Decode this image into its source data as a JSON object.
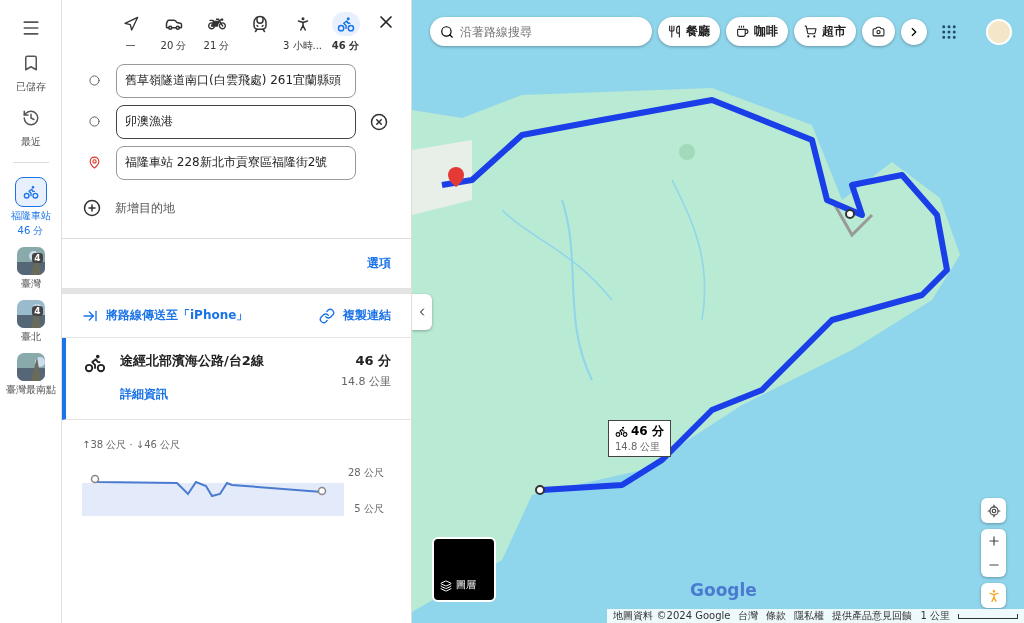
{
  "rail": {
    "items": [
      {
        "kind": "saved",
        "label": "已儲存",
        "selected": false
      },
      {
        "kind": "recent",
        "label": "最近",
        "selected": false
      },
      {
        "kind": "route",
        "label": "福隆車站",
        "sub": "46 分",
        "selected": true
      },
      {
        "kind": "place",
        "label": "臺灣",
        "count": "4",
        "selected": false
      },
      {
        "kind": "place",
        "label": "臺北",
        "count": "4",
        "selected": false
      },
      {
        "kind": "place",
        "label": "臺灣最南點",
        "selected": false
      }
    ]
  },
  "modes": [
    {
      "kind": "best",
      "time": "—",
      "selected": false
    },
    {
      "kind": "car",
      "time": "20 分",
      "selected": false
    },
    {
      "kind": "motorcycle",
      "time": "21 分",
      "selected": false
    },
    {
      "kind": "transit",
      "selected": false
    },
    {
      "kind": "walk",
      "time": "3 小時...",
      "selected": false
    },
    {
      "kind": "bike",
      "time": "46 分",
      "selected": true
    }
  ],
  "waypoints": [
    {
      "kind": "start",
      "value": "舊草嶺隧道南口(白雲飛處) 261宜蘭縣頭",
      "focused": false,
      "removable": false
    },
    {
      "kind": "stop",
      "value": "卯澳漁港",
      "focused": true,
      "removable": true
    },
    {
      "kind": "end",
      "value": "福隆車站 228新北市貢寮區福隆街2號",
      "focused": false,
      "removable": false
    }
  ],
  "add_destination": "新增目的地",
  "options": "選項",
  "send_to_device": "將路線傳送至「iPhone」",
  "copy_link": "複製連結",
  "route": {
    "title": "途經北部濱海公路/台2線",
    "time": "46 分",
    "distance": "14.8 公里",
    "details": "詳細資訊",
    "selected": true
  },
  "elevation": {
    "summary": "↑38 公尺 · ↓46 公尺",
    "max_label": "28 公尺",
    "min_label": "5 公尺"
  },
  "map": {
    "search": {
      "placeholder": "沿著路線搜尋"
    },
    "chips": [
      {
        "kind": "food",
        "label": "餐廳"
      },
      {
        "kind": "coffee",
        "label": "咖啡"
      },
      {
        "kind": "shop",
        "label": "超市"
      },
      {
        "kind": "camera"
      }
    ],
    "callout": {
      "time": "46 分",
      "distance": "14.8 公里"
    },
    "layers": "圖層",
    "logo": "Google",
    "footer": [
      "地圖資料 ©2024 Google",
      "台灣",
      "條款",
      "隱私權",
      "提供產品意見回饋"
    ],
    "scale": "1 公里"
  }
}
